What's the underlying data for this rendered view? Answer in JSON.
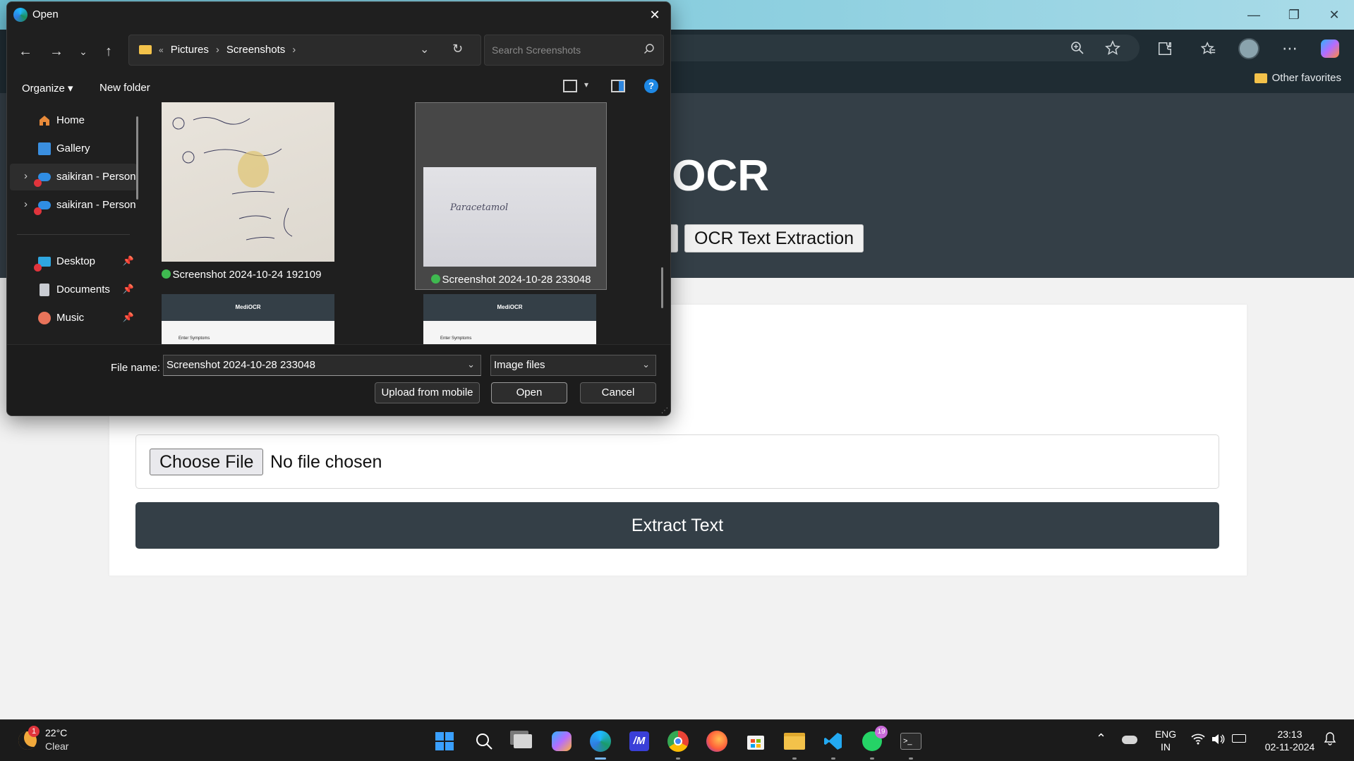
{
  "browser": {
    "other_favorites": "Other favorites",
    "controls": {
      "minimize": "—",
      "restore": "❐",
      "close": "✕"
    }
  },
  "page": {
    "title": "iOCR",
    "nav_buttons": [
      "OCR Text Extraction"
    ],
    "file_input": {
      "button": "Choose File",
      "status": "No file chosen"
    },
    "extract_button": "Extract Text",
    "colors": {
      "header": "#343f47",
      "button": "#343f47",
      "background": "#f2f2f2"
    }
  },
  "dialog": {
    "title": "Open",
    "breadcrumb": {
      "sep_start": "«",
      "items": [
        "Pictures",
        "Screenshots"
      ]
    },
    "search_placeholder": "Search Screenshots",
    "commands": {
      "organize": "Organize",
      "new_folder": "New folder"
    },
    "nav_items": [
      {
        "label": "Home",
        "icon": "home-icon",
        "pinned": false
      },
      {
        "label": "Gallery",
        "icon": "gallery-icon",
        "pinned": false
      },
      {
        "label": "saikiran - Person",
        "icon": "onedrive-icon",
        "pinned": false
      },
      {
        "label": "saikiran - Person",
        "icon": "onedrive-icon",
        "pinned": false
      },
      {
        "label": "Desktop",
        "icon": "desktop-icon",
        "pinned": true
      },
      {
        "label": "Documents",
        "icon": "documents-icon",
        "pinned": true
      },
      {
        "label": "Music",
        "icon": "music-icon",
        "pinned": true
      }
    ],
    "files": [
      {
        "name": "Screenshot 2024-10-24 192109",
        "selected": false
      },
      {
        "name": "Screenshot 2024-10-28 233048",
        "selected": true
      }
    ],
    "thumb_texts": {
      "handwritten_note": "Paracetamol",
      "mini_page_title": "MediOCR",
      "mini_section": "Enter Symptoms"
    },
    "file_name_label": "File name:",
    "file_name_value": "Screenshot 2024-10-28 233048",
    "file_type": "Image files",
    "buttons": {
      "upload_mobile": "Upload from mobile",
      "open": "Open",
      "cancel": "Cancel"
    }
  },
  "taskbar": {
    "weather": {
      "temp": "22°C",
      "condition": "Clear",
      "badge": "1"
    },
    "apps": [
      "start-icon",
      "search-icon",
      "task-view-icon",
      "copilot-icon",
      "edge-icon",
      "app-icon",
      "chrome-icon",
      "firefox-icon",
      "store-icon",
      "file-explorer-icon",
      "vscode-icon",
      "whatsapp-icon",
      "terminal-icon"
    ],
    "whatsapp_badge": "19",
    "lang": {
      "line1": "ENG",
      "line2": "IN"
    },
    "clock": {
      "time": "23:13",
      "date": "02-11-2024"
    }
  }
}
